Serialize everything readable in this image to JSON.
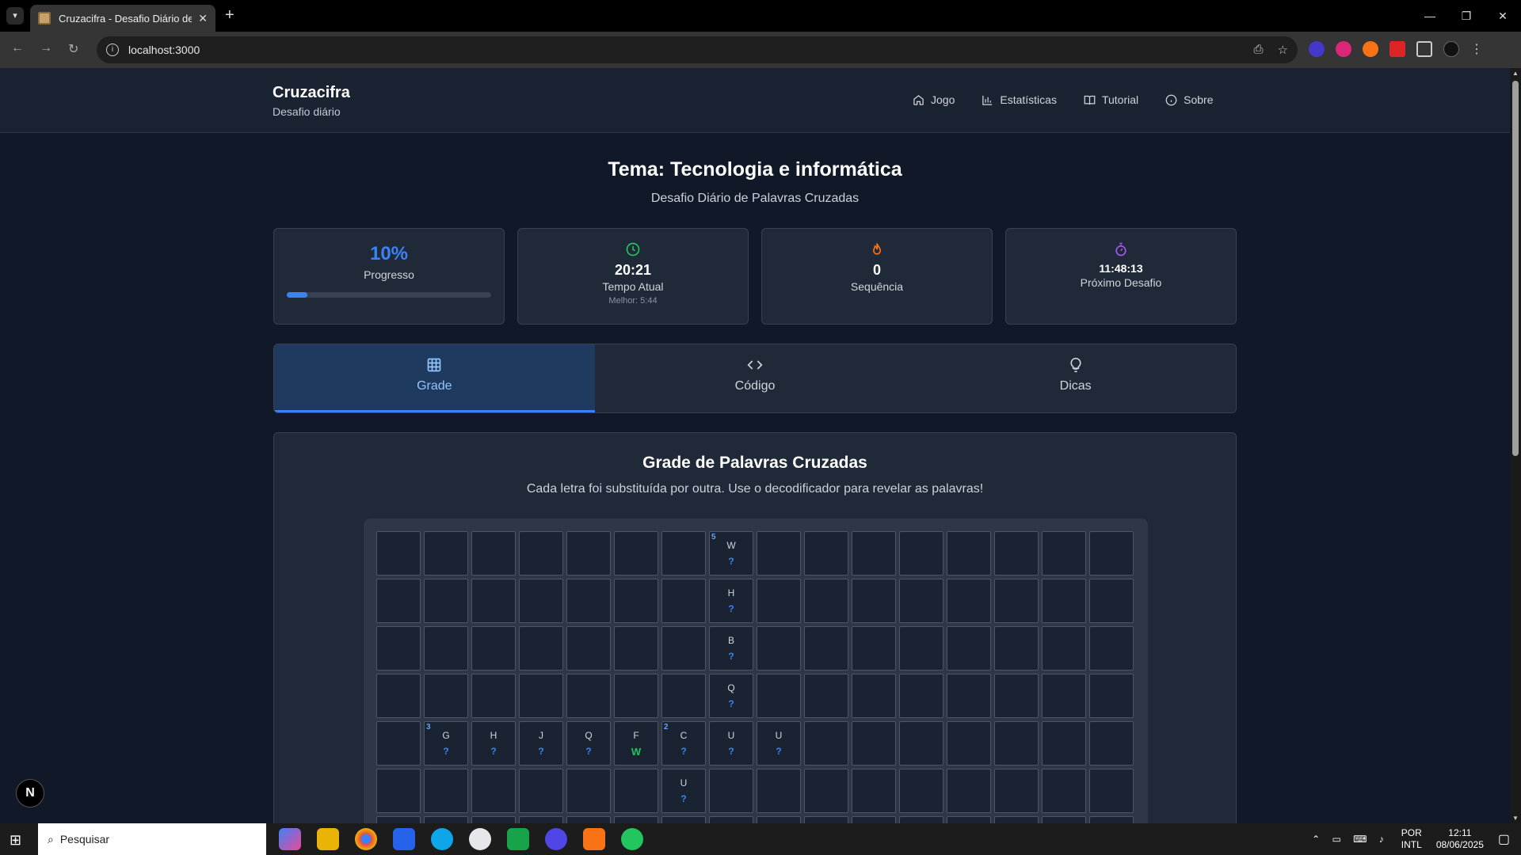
{
  "browser": {
    "tab_title": "Cruzacifra - Desafio Diário de C",
    "url": "localhost:3000"
  },
  "header": {
    "brand": "Cruzacifra",
    "subtitle": "Desafio diário",
    "nav": [
      {
        "label": "Jogo",
        "icon": "home-icon"
      },
      {
        "label": "Estatísticas",
        "icon": "bar-chart-icon"
      },
      {
        "label": "Tutorial",
        "icon": "book-icon"
      },
      {
        "label": "Sobre",
        "icon": "info-icon"
      }
    ]
  },
  "main": {
    "theme_title": "Tema: Tecnologia e informática",
    "theme_subtitle": "Desafio Diário de Palavras Cruzadas"
  },
  "stats": {
    "progress_value": "10%",
    "progress_label": "Progresso",
    "progress_fraction": 0.1,
    "time_value": "20:21",
    "time_label": "Tempo Atual",
    "time_best": "Melhor: 5:44",
    "streak_value": "0",
    "streak_label": "Sequência",
    "next_value": "11:48:13",
    "next_label": "Próximo Desafio"
  },
  "tabs": [
    {
      "label": "Grade",
      "icon": "grid-icon",
      "active": true
    },
    {
      "label": "Código",
      "icon": "code-icon",
      "active": false
    },
    {
      "label": "Dicas",
      "icon": "lightbulb-icon",
      "active": false
    }
  ],
  "panel": {
    "title": "Grade de Palavras Cruzadas",
    "subtitle": "Cada letra foi substituída por outra. Use o decodificador para revelar as palavras!"
  },
  "grid": {
    "cols": 16,
    "cells": [
      {
        "row": 0,
        "col": 7,
        "num": "5",
        "cipher": "W",
        "guess": "?"
      },
      {
        "row": 1,
        "col": 7,
        "cipher": "H",
        "guess": "?"
      },
      {
        "row": 2,
        "col": 7,
        "cipher": "B",
        "guess": "?"
      },
      {
        "row": 3,
        "col": 7,
        "cipher": "Q",
        "guess": "?"
      },
      {
        "row": 4,
        "col": 1,
        "num": "3",
        "cipher": "G",
        "guess": "?"
      },
      {
        "row": 4,
        "col": 2,
        "cipher": "H",
        "guess": "?"
      },
      {
        "row": 4,
        "col": 3,
        "cipher": "J",
        "guess": "?"
      },
      {
        "row": 4,
        "col": 4,
        "cipher": "Q",
        "guess": "?"
      },
      {
        "row": 4,
        "col": 5,
        "cipher": "F",
        "guess": "W",
        "solved": true
      },
      {
        "row": 4,
        "col": 6,
        "num": "2",
        "cipher": "C",
        "guess": "?"
      },
      {
        "row": 4,
        "col": 7,
        "cipher": "U",
        "guess": "?"
      },
      {
        "row": 4,
        "col": 8,
        "cipher": "U",
        "guess": "?"
      },
      {
        "row": 5,
        "col": 6,
        "cipher": "U",
        "guess": "?"
      }
    ]
  },
  "devtools_badge": "N",
  "taskbar": {
    "search_placeholder": "Pesquisar",
    "lang_top": "POR",
    "lang_bottom": "INTL",
    "time": "12:11",
    "date": "08/06/2025"
  },
  "colors": {
    "accent": "#3b82f6",
    "solved": "#22c55e",
    "page_bg": "#111827",
    "card_bg": "#1f2937"
  }
}
